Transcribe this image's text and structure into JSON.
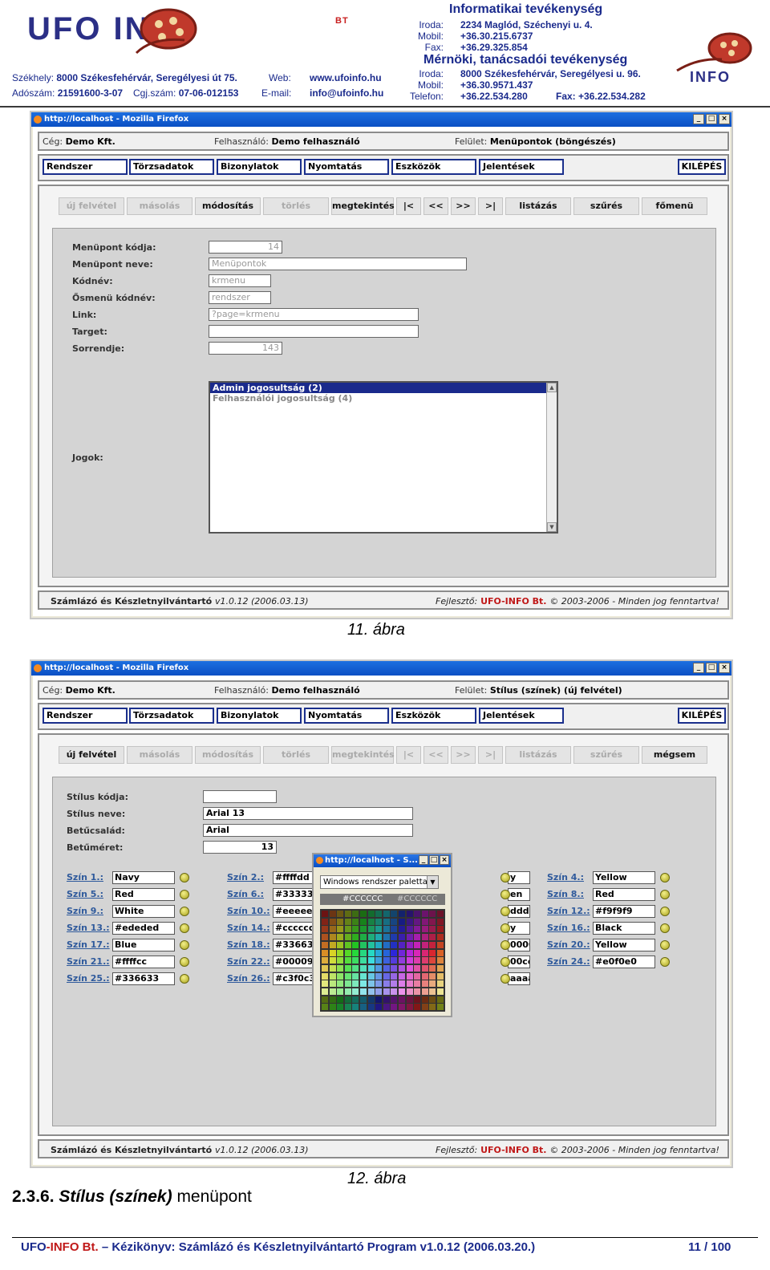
{
  "letterhead": {
    "logo_text": "UFO INFO",
    "logo_suffix": "BT",
    "logo_right_text": "INFO",
    "seat": "Székhely:",
    "seat_address": "8000 Székesfehérvár, Seregélyesi út 75.",
    "tax": "Adószám:",
    "tax_value": "21591600-3-07",
    "reg": "Cgj.szám:",
    "reg_value": "07-06-012153",
    "web_label": "Web:",
    "web_value": "www.ufoinfo.hu",
    "email_label": "E-mail:",
    "email_value": "info@ufoinfo.hu",
    "it_title": "Informatikai tevékenység",
    "it_office_label": "Iroda:",
    "it_office_value": "2234 Maglód, Széchenyi u. 4.",
    "it_mobile_label": "Mobil:",
    "it_mobile_value": "+36.30.215.6737",
    "it_fax_label": "Fax:",
    "it_fax_value": "+36.29.325.854",
    "eng_title": "Mérnöki, tanácsadói tevékenység",
    "eng_office_label": "Iroda:",
    "eng_office_value": "8000 Székesfehérvár, Seregélyesi u. 96.",
    "eng_mobile_label": "Mobil:",
    "eng_mobile_value": "+36.30.9571.437",
    "eng_phone_label": "Telefon:",
    "eng_phone_value": "+36.22.534.280",
    "eng_fax": "Fax: +36.22.534.282"
  },
  "common": {
    "window_title": "http://localhost - Mozilla Firefox",
    "win_min": "_",
    "win_max": "□",
    "win_close": "×",
    "company_label": "Cég:",
    "company_value": "Demo Kft.",
    "user_label": "Felhasználó:",
    "user_value": "Demo felhasználó",
    "surface_label": "Felület:",
    "menu": [
      "Rendszer",
      "Törzsadatok",
      "Bizonylatok",
      "Nyomtatás",
      "Eszközök",
      "Jelentések"
    ],
    "exit": "KILÉPÉS",
    "footer_app": "Számlázó és Készletnyilvántartó",
    "footer_version": "v1.0.12 (2006.03.13)",
    "footer_dev_label": "Fejlesztő:",
    "footer_dev_value": "UFO-INFO Bt.",
    "footer_rights": "© 2003-2006 - Minden jog fenntartva!"
  },
  "fig11": {
    "surface_value": "Menüpontok (böngészés)",
    "toolbar": [
      {
        "label": "új felvétel",
        "enabled": false
      },
      {
        "label": "másolás",
        "enabled": false
      },
      {
        "label": "módosítás",
        "enabled": true
      },
      {
        "label": "törlés",
        "enabled": false
      },
      {
        "label": "megtekintés",
        "enabled": true
      },
      {
        "label": "|<",
        "enabled": true
      },
      {
        "label": "<<",
        "enabled": true
      },
      {
        "label": ">>",
        "enabled": true
      },
      {
        "label": ">|",
        "enabled": true
      },
      {
        "label": "listázás",
        "enabled": true
      },
      {
        "label": "szűrés",
        "enabled": true
      },
      {
        "label": "főmenü",
        "enabled": true
      }
    ],
    "fields": {
      "code_label": "Menüpont kódja:",
      "code_value": "14",
      "name_label": "Menüpont neve:",
      "name_value": "Menüpontok",
      "codename_label": "Kódnév:",
      "codename_value": "krmenu",
      "parent_label": "Ősmenü kódnév:",
      "parent_value": "rendszer",
      "link_label": "Link:",
      "link_value": "?page=krmenu",
      "target_label": "Target:",
      "target_value": "",
      "order_label": "Sorrendje:",
      "order_value": "143",
      "rights_label": "Jogok:"
    },
    "rights": [
      "Admin jogosultság (2)",
      "Felhasználói jogosultság (4)"
    ],
    "caption": "11. ábra"
  },
  "fig12": {
    "surface_value": "Stílus (színek) (új felvétel)",
    "toolbar": [
      {
        "label": "új felvétel",
        "enabled": true
      },
      {
        "label": "másolás",
        "enabled": false
      },
      {
        "label": "módosítás",
        "enabled": false
      },
      {
        "label": "törlés",
        "enabled": false
      },
      {
        "label": "megtekintés",
        "enabled": false
      },
      {
        "label": "|<",
        "enabled": false
      },
      {
        "label": "<<",
        "enabled": false
      },
      {
        "label": ">>",
        "enabled": false
      },
      {
        "label": ">|",
        "enabled": false
      },
      {
        "label": "listázás",
        "enabled": false
      },
      {
        "label": "szűrés",
        "enabled": false
      },
      {
        "label": "mégsem",
        "enabled": true
      }
    ],
    "fields": {
      "code_label": "Stílus kódja:",
      "code_value": "",
      "name_label": "Stílus neve:",
      "name_value": "Arial 13",
      "font_label": "Betűcsalád:",
      "font_value": "Arial",
      "size_label": "Betűméret:",
      "size_value": "13"
    },
    "colors": [
      {
        "label": "Szín 1.:",
        "value": "Navy"
      },
      {
        "label": "Szín 2.:",
        "value": "#ffffdd"
      },
      {
        "label": "",
        "value": "y"
      },
      {
        "label": "Szín 4.:",
        "value": "Yellow"
      },
      {
        "label": "Szín 5.:",
        "value": "Red"
      },
      {
        "label": "Szín 6.:",
        "value": "#33333"
      },
      {
        "label": "",
        "value": "en"
      },
      {
        "label": "Szín 8.:",
        "value": "Red"
      },
      {
        "label": "Szín 9.:",
        "value": "White"
      },
      {
        "label": "Szín 10.:",
        "value": "#eeeeee"
      },
      {
        "label": "",
        "value": "dddd"
      },
      {
        "label": "Szín 12.:",
        "value": "#f9f9f9"
      },
      {
        "label": "Szín 13.:",
        "value": "#ededed"
      },
      {
        "label": "Szín 14.:",
        "value": "#cccccc"
      },
      {
        "label": "",
        "value": "y"
      },
      {
        "label": "Szín 16.:",
        "value": "Black"
      },
      {
        "label": "Szín 17.:",
        "value": "Blue"
      },
      {
        "label": "Szín 18.:",
        "value": "#336633"
      },
      {
        "label": "",
        "value": "0000"
      },
      {
        "label": "Szín 20.:",
        "value": "Yellow"
      },
      {
        "label": "Szín 21.:",
        "value": "#ffffcc"
      },
      {
        "label": "Szín 22.:",
        "value": "#000099"
      },
      {
        "label": "",
        "value": "00cc"
      },
      {
        "label": "Szín 24.:",
        "value": "#e0f0e0"
      },
      {
        "label": "Szín 25.:",
        "value": "#336633"
      },
      {
        "label": "Szín 26.:",
        "value": "#c3f0c3"
      },
      {
        "label": "",
        "value": "aaaa"
      }
    ],
    "palette": {
      "title": "http://localhost - S...",
      "select_value": "Windows rendszer paletta",
      "preview_value": "#CCCCCC",
      "preview_value2": "#CCCCCC"
    },
    "caption": "12. ábra"
  },
  "section": {
    "number": "2.3.6.",
    "title": "Stílus (színek)",
    "suffix": "menüpont"
  },
  "page_footer": {
    "company_a": "UFO",
    "company_b": "-INFO Bt.",
    "title": "– Kézikönyv: Számlázó és Készletnyilvántartó Program v1.0.12 (2006.03.20.)",
    "page": "11 / 100"
  }
}
